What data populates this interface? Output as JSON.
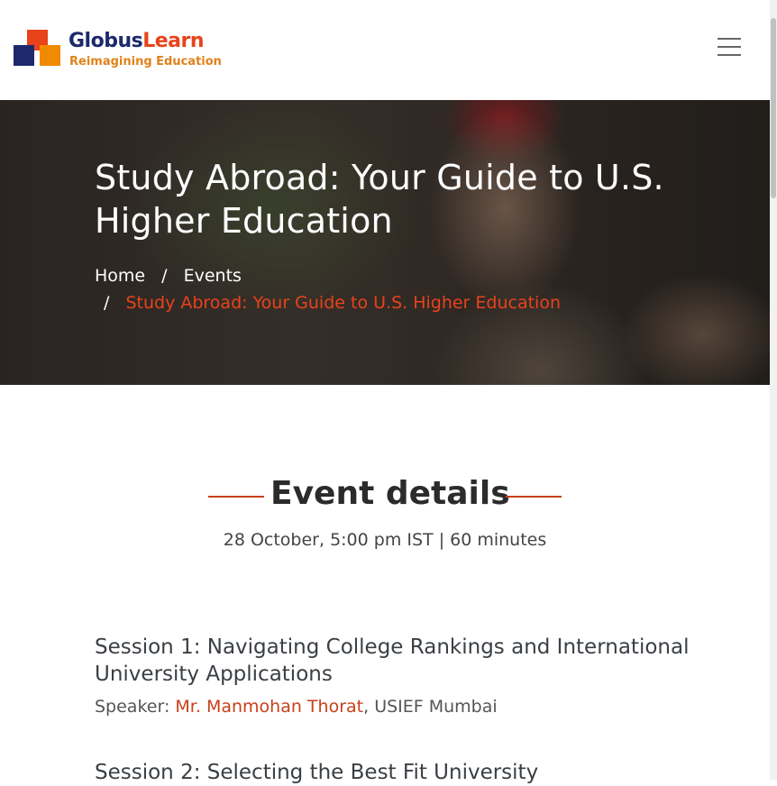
{
  "header": {
    "brand_part1": "Globus",
    "brand_part2": "Learn",
    "tagline": "Reimagining Education",
    "menu_icon": "hamburger-menu-icon"
  },
  "hero": {
    "title": "Study Abroad: Your Guide to U.S. Higher Education",
    "breadcrumb": {
      "home": "Home",
      "separator": "/",
      "events": "Events",
      "current": "Study Abroad: Your Guide to U.S. Higher Education"
    }
  },
  "event": {
    "heading": "Event details",
    "meta": "28 October, 5:00 pm IST | 60 minutes"
  },
  "sessions": [
    {
      "title": "Session 1: Navigating College Rankings and International University Applications",
      "speaker_label": "Speaker:",
      "speaker_name": "Mr. Manmohan Thorat",
      "speaker_org": ", USIEF Mumbai"
    },
    {
      "title": "Session 2: Selecting the Best Fit University"
    }
  ],
  "colors": {
    "brand_navy": "#1c2a6c",
    "brand_red": "#e8431b",
    "brand_orange": "#f08a00",
    "accent": "#c7401a"
  }
}
